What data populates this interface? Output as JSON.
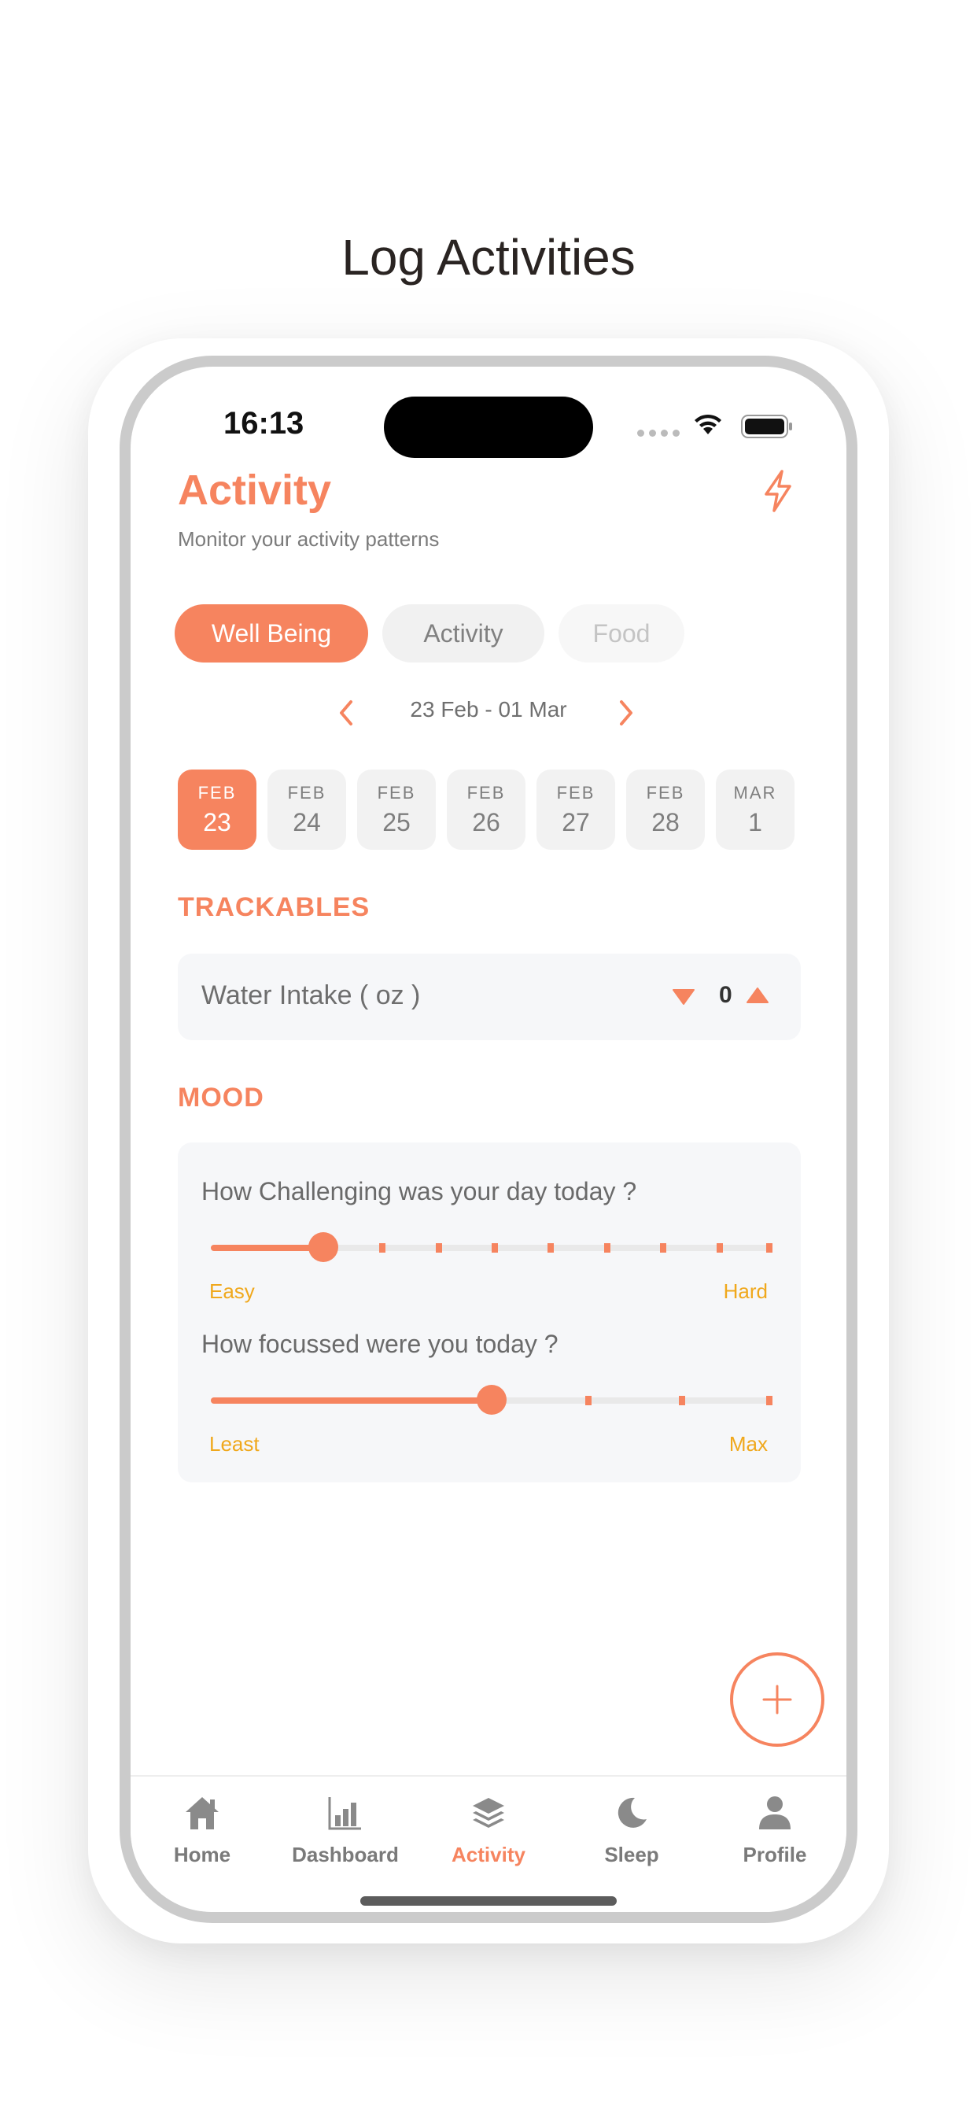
{
  "page": {
    "title": "Log Activities"
  },
  "status_bar": {
    "time": "16:13"
  },
  "header": {
    "title": "Activity",
    "subtitle": "Monitor your activity patterns",
    "action_icon": "bolt-icon"
  },
  "tabs": [
    {
      "label": "Well Being",
      "state": "active"
    },
    {
      "label": "Activity",
      "state": "normal"
    },
    {
      "label": "Food",
      "state": "disabled"
    }
  ],
  "date_range": {
    "label": "23 Feb - 01 Mar"
  },
  "days": [
    {
      "month": "FEB",
      "day": "23",
      "selected": true
    },
    {
      "month": "FEB",
      "day": "24",
      "selected": false
    },
    {
      "month": "FEB",
      "day": "25",
      "selected": false
    },
    {
      "month": "FEB",
      "day": "26",
      "selected": false
    },
    {
      "month": "FEB",
      "day": "27",
      "selected": false
    },
    {
      "month": "FEB",
      "day": "28",
      "selected": false
    },
    {
      "month": "MAR",
      "day": "1",
      "selected": false
    }
  ],
  "trackables": {
    "section_label": "TRACKABLES",
    "water": {
      "label": "Water Intake ( oz )",
      "value": "0"
    }
  },
  "mood": {
    "section_label": "MOOD",
    "questions": [
      {
        "text": "How Challenging was your day today ?",
        "min_label": "Easy",
        "max_label": "Hard",
        "steps": 10,
        "value": 2
      },
      {
        "text": "How focussed were you today ?",
        "min_label": "Least",
        "max_label": "Max",
        "steps": 6,
        "value": 3
      }
    ]
  },
  "tab_bar": [
    {
      "label": "Home",
      "icon": "home-icon",
      "active": false
    },
    {
      "label": "Dashboard",
      "icon": "bar-chart-icon",
      "active": false
    },
    {
      "label": "Activity",
      "icon": "layers-icon",
      "active": true
    },
    {
      "label": "Sleep",
      "icon": "moon-icon",
      "active": false
    },
    {
      "label": "Profile",
      "icon": "person-icon",
      "active": false
    }
  ],
  "colors": {
    "accent": "#f6845f",
    "slider_label": "#f0a81c",
    "muted": "#7a7a7a"
  }
}
